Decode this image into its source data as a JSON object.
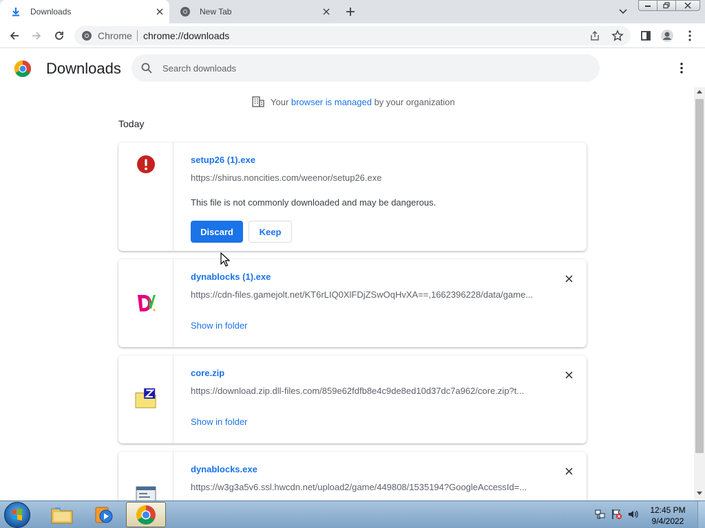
{
  "tabs": [
    {
      "title": "Downloads",
      "icon": "download-icon",
      "active": true
    },
    {
      "title": "New Tab",
      "icon": "chrome-icon",
      "active": false
    }
  ],
  "toolbar": {
    "site_chip": "Chrome",
    "url": "chrome://downloads"
  },
  "page": {
    "title": "Downloads",
    "search_placeholder": "Search downloads",
    "managed_prefix": "Your ",
    "managed_link": "browser is managed",
    "managed_suffix": " by your organization",
    "section": "Today"
  },
  "downloads": [
    {
      "name": "setup26 (1).exe",
      "url": "https://shirus.noncities.com/weenor/setup26.exe",
      "warning": "This file is not commonly downloaded and may be dangerous.",
      "primary_action": "Discard",
      "secondary_action": "Keep",
      "icon": "danger-icon"
    },
    {
      "name": "dynablocks (1).exe",
      "url": "https://cdn-files.gamejolt.net/KT6rLIQ0XlFDjZSwOqHvXA==,1662396228/data/game...",
      "action": "Show in folder",
      "icon": "dynablocks-icon"
    },
    {
      "name": "core.zip",
      "url": "https://download.zip.dll-files.com/859e62fdfb8e4c9de8ed10d37dc7a962/core.zip?t...",
      "action": "Show in folder",
      "icon": "zip-folder-icon"
    },
    {
      "name": "dynablocks.exe",
      "url": "https://w3g3a5v6.ssl.hwcdn.net/upload2/game/449808/1535194?GoogleAccessId=...",
      "icon": "exe-file-icon"
    }
  ],
  "taskbar": {
    "time": "12:45 PM",
    "date": "9/4/2022"
  },
  "colors": {
    "accent": "#1a73e8",
    "danger": "#c5221f",
    "tabstrip": "#dee1e6"
  }
}
